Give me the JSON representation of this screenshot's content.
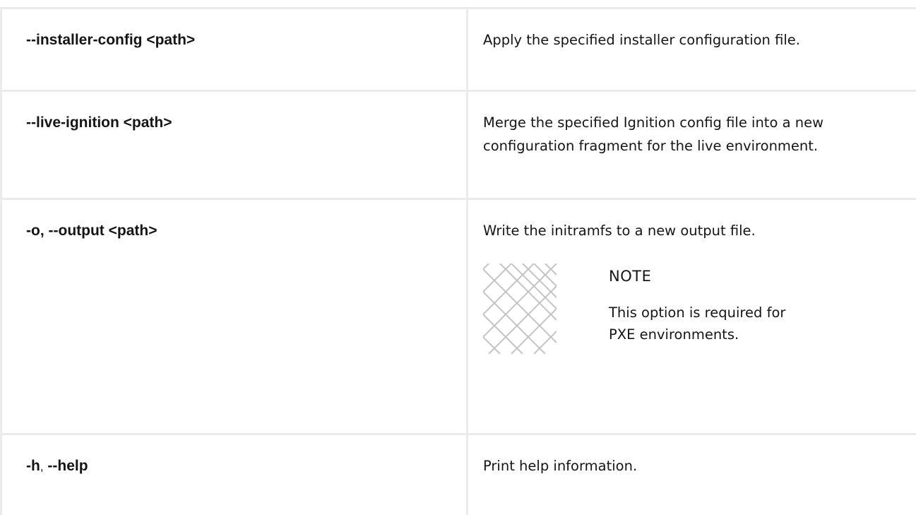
{
  "rows": [
    {
      "option": "--installer-config <path>",
      "description": "Apply the specified installer configuration file."
    },
    {
      "option": "--live-ignition <path>",
      "description": "Merge the specified Ignition config file into a new configuration fragment for the live environment."
    },
    {
      "option_part1": "-o,",
      "option_part2": "--output <path>",
      "description": "Write the initramfs to a new output file.",
      "note": {
        "title": "NOTE",
        "text": "This option is required for PXE environments.",
        "icon": "note-diamond-pattern-icon"
      }
    },
    {
      "option_part1": "-h",
      "separator": ",",
      "option_part2": "--help",
      "description": "Print help information."
    }
  ],
  "colors": {
    "text": "#151515",
    "border": "#ebebeb",
    "icon_stroke": "#c4c4c4"
  }
}
